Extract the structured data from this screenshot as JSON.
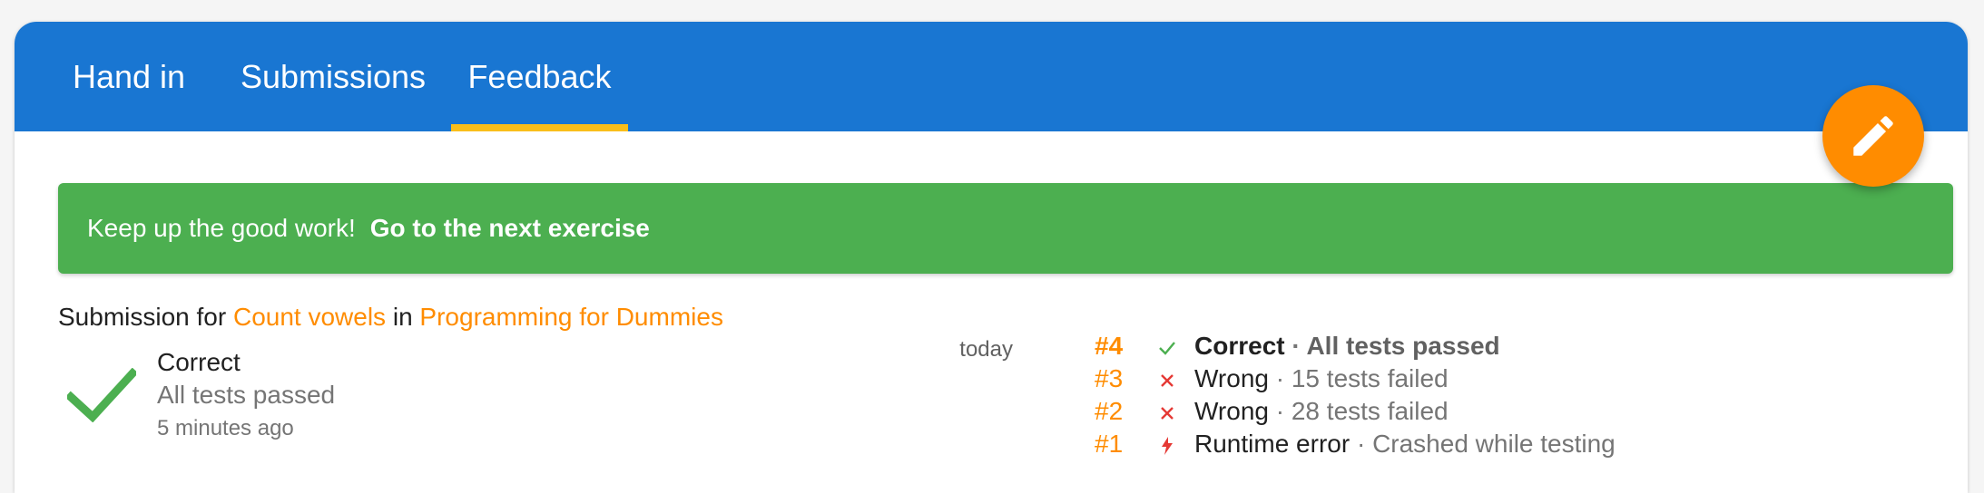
{
  "tabs": [
    {
      "label": "Hand in"
    },
    {
      "label": "Submissions"
    },
    {
      "label": "Feedback"
    }
  ],
  "banner": {
    "message": "Keep up the good work!",
    "link": "Go to the next exercise"
  },
  "submission": {
    "prefix": "Submission for",
    "exercise": "Count vowels",
    "connector": "in",
    "course": "Programming for Dummies",
    "status": "Correct",
    "summary": "All tests passed",
    "time": "5 minutes ago"
  },
  "history": [
    {
      "day": "today",
      "num": "#4",
      "icon": "check-icon",
      "status": "Correct",
      "sep": " · ",
      "detail": "All tests passed"
    },
    {
      "day": "",
      "num": "#3",
      "icon": "cross-icon",
      "status": "Wrong",
      "sep": " · ",
      "detail": "15 tests failed"
    },
    {
      "day": "",
      "num": "#2",
      "icon": "cross-icon",
      "status": "Wrong",
      "sep": " · ",
      "detail": "28 tests failed"
    },
    {
      "day": "",
      "num": "#1",
      "icon": "lightning-icon",
      "status": "Runtime error",
      "sep": " · ",
      "detail": "Crashed while testing"
    }
  ],
  "colors": {
    "primary": "#1976d2",
    "tab_indicator": "#f9be1a",
    "accent": "#ff8c00",
    "success": "#4caf50",
    "error": "#e53935"
  },
  "icons": {
    "fab": "pencil-icon",
    "status": "check-icon"
  }
}
